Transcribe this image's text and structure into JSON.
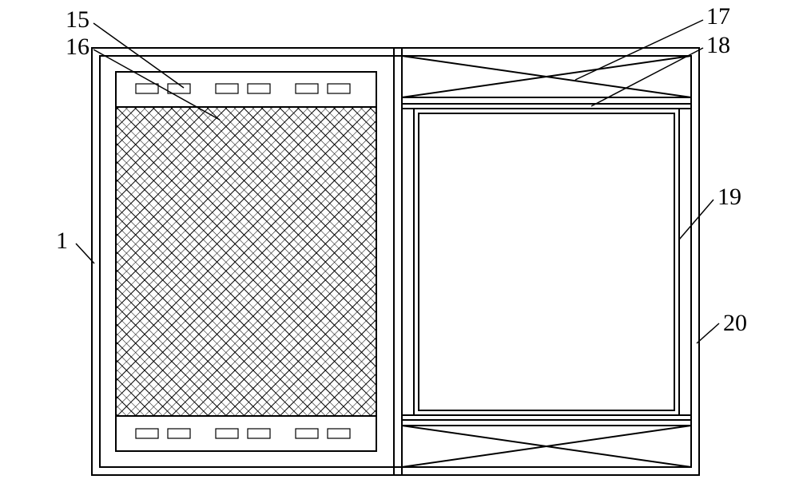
{
  "labels": {
    "l1": "1",
    "l15": "15",
    "l16": "16",
    "l17": "17",
    "l18": "18",
    "l19": "19",
    "l20": "20"
  }
}
